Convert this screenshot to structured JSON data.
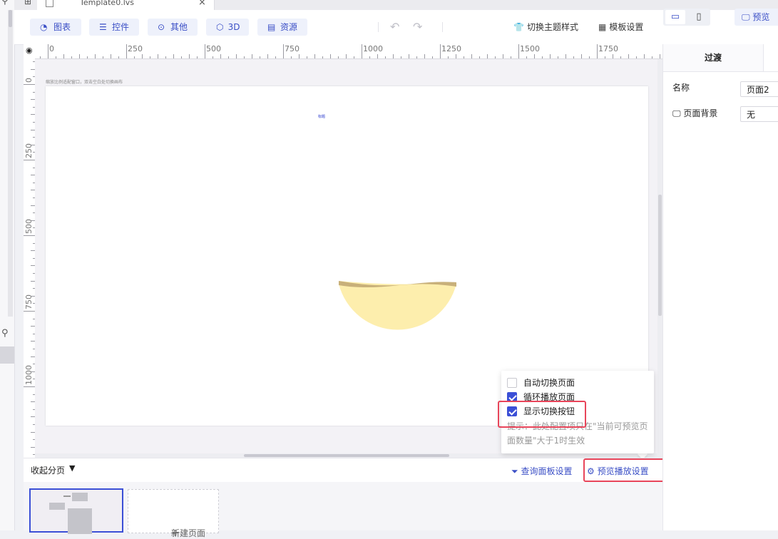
{
  "file_tab": {
    "name": "Template0.lvs"
  },
  "toolbar": {
    "chart": "图表",
    "control": "控件",
    "other": "其他",
    "threed": "3D",
    "resource": "资源",
    "switch_theme": "切换主题样式",
    "template_settings": "模板设置",
    "preview": "预览"
  },
  "ruler": {
    "h_labels": [
      "0",
      "250",
      "500",
      "750",
      "1000",
      "1250",
      "1500",
      "1750"
    ],
    "v_labels": [
      "0",
      "250",
      "500",
      "750",
      "1000"
    ]
  },
  "canvas": {
    "caption": "缩放比例适配窗口，双击空白处切换画布",
    "tiny_mark": "标题"
  },
  "popover": {
    "auto_switch": "自动切换页面",
    "auto_switch_checked": false,
    "loop_play": "循环播放页面",
    "loop_play_checked": true,
    "show_switch_btn": "显示切换按钮",
    "show_switch_btn_checked": true,
    "hint": "提示：此处配置项只在\"当前可预览页面数量\"大于1时生效"
  },
  "bottom_bar": {
    "collapse": "收起分页",
    "query_panel_settings": "查询面板设置",
    "preview_play_settings": "预览播放设置"
  },
  "pages": {
    "new_page": "新建页面"
  },
  "right_panel": {
    "tab_transition": "过渡",
    "name_label": "名称",
    "name_value": "页面2",
    "bg_label": "页面背景",
    "bg_value": "无"
  },
  "colors": {
    "accent": "#3b4fd6",
    "highlight": "#e8455a",
    "bowl_fill": "#fdeead",
    "bowl_rim": "#c8b07a"
  }
}
